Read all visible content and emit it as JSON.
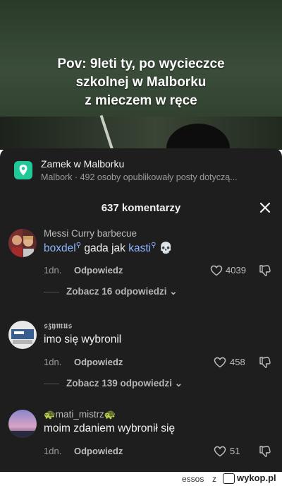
{
  "video": {
    "caption_lines": [
      "Pov: 9leti ty, po wycieczce",
      "szkolnej w Malborku",
      "z mieczem w ręce"
    ]
  },
  "location": {
    "title": "Zamek w Malborku",
    "subtitle": "Malbork · 492 osoby opublikowały posty dotyczą...",
    "icon": "location-pin-icon",
    "color": "#20c997"
  },
  "header": {
    "count_label": "637 komentarzy",
    "close_icon": "close-icon"
  },
  "comments": [
    {
      "username": "Messi Curry barbecue",
      "mention1": "boxdel",
      "middle": " gada jak ",
      "mention2": "kasti",
      "emoji": "💀",
      "time": "1dn.",
      "reply": "Odpowiedz",
      "likes": "4039",
      "replies": "Zobacz 16 odpowiedzi"
    },
    {
      "username": "𝖘𝖟𝖞𝖒𝖚𝖘",
      "text": "imo się wybronil",
      "time": "1dn.",
      "reply": "Odpowiedz",
      "likes": "458",
      "replies": "Zobacz 139 odpowiedzi"
    },
    {
      "username": "🐢mati_mistrz🐢",
      "text": "moim zdaniem wybronił się",
      "time": "1dn.",
      "reply": "Odpowiedz",
      "likes": "51"
    }
  ],
  "footer": {
    "user": "essos",
    "z": "z",
    "site": "wykop.pl"
  }
}
